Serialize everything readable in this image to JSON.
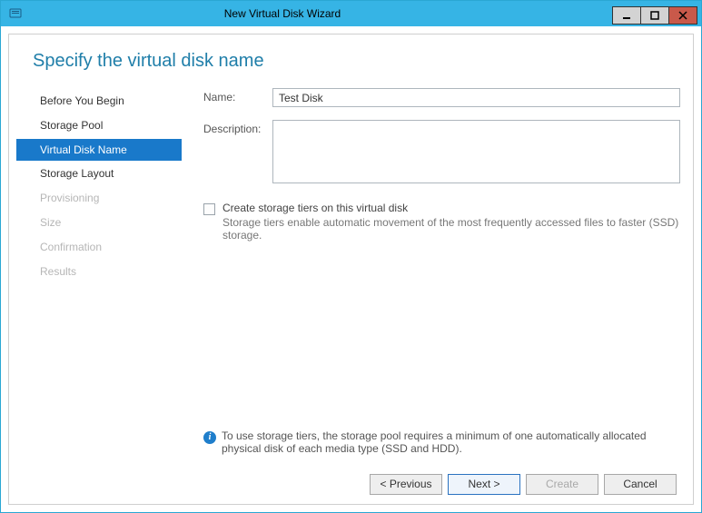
{
  "window": {
    "title": "New Virtual Disk Wizard"
  },
  "heading": "Specify the virtual disk name",
  "sidebar": {
    "items": [
      {
        "label": "Before You Begin",
        "state": "clickable"
      },
      {
        "label": "Storage Pool",
        "state": "clickable"
      },
      {
        "label": "Virtual Disk Name",
        "state": "active"
      },
      {
        "label": "Storage Layout",
        "state": "clickable"
      },
      {
        "label": "Provisioning",
        "state": "disabled"
      },
      {
        "label": "Size",
        "state": "disabled"
      },
      {
        "label": "Confirmation",
        "state": "disabled"
      },
      {
        "label": "Results",
        "state": "disabled"
      }
    ]
  },
  "form": {
    "name_label": "Name:",
    "name_value": "Test Disk",
    "desc_label": "Description:",
    "desc_value": "",
    "tier_checkbox_label": "Create storage tiers on this virtual disk",
    "tier_checkbox_desc": "Storage tiers enable automatic movement of the most frequently accessed files to faster (SSD) storage.",
    "info_text": "To use storage tiers, the storage pool requires a minimum of one automatically allocated physical disk of each media type (SSD and HDD)."
  },
  "footer": {
    "previous": "< Previous",
    "next": "Next >",
    "create": "Create",
    "cancel": "Cancel"
  }
}
